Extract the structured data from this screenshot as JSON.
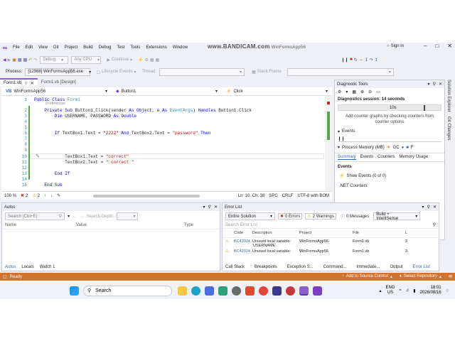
{
  "menu": {
    "items": [
      "File",
      "Edit",
      "View",
      "Git",
      "Project",
      "Build",
      "Debug",
      "Test",
      "Tools",
      "Extensions",
      "Window"
    ],
    "overlay": "www.BANDICAM.com",
    "app_name": "WinFormsApp56",
    "sign_in": "Sign in"
  },
  "toolbar": {
    "debug_config": "Debug",
    "cpu": "Any CPU",
    "continue": "Continue",
    "stack_frame_label": "Stack Frame"
  },
  "process_bar": {
    "label": "Process:",
    "value": "[12988] WinFormsApp56.exe",
    "lifecycle": "Lifecycle Events",
    "thread": "Thread:"
  },
  "tabs": [
    "Form1.vb",
    "Form1.vb [Design]"
  ],
  "editor_nav": {
    "project": "WinFormsApp56",
    "object": "Button1",
    "event": "Click"
  },
  "code": {
    "refs": "0 references",
    "lines": [
      {
        "n": "1",
        "parts": [
          [
            "kw",
            "Public Class "
          ],
          [
            "ty",
            "Form1"
          ]
        ]
      },
      {
        "n": "2",
        "parts": [
          [
            "kw",
            "    Private Sub "
          ],
          [
            "",
            "Button1_Click(sender "
          ],
          [
            "kw",
            "As Object"
          ],
          [
            "",
            ", e "
          ],
          [
            "kw",
            "As "
          ],
          [
            "ty",
            "EventArgs"
          ],
          [
            "",
            ") "
          ],
          [
            "kw",
            "Handles "
          ],
          [
            "",
            "Button1.Click"
          ]
        ]
      },
      {
        "n": "3",
        "parts": [
          [
            "kw",
            "        Dim "
          ],
          [
            "",
            "USERNAME, PASSWORD "
          ],
          [
            "kw",
            "As Double"
          ]
        ]
      },
      {
        "n": "4",
        "parts": []
      },
      {
        "n": "5",
        "parts": []
      },
      {
        "n": "6",
        "parts": [
          [
            "kw",
            "        If "
          ],
          [
            "",
            "TextBox1.Text = "
          ],
          [
            "st",
            "\"2222\""
          ],
          [
            "kw",
            " And "
          ],
          [
            "",
            "TextBox2.Text = "
          ],
          [
            "st",
            "\"password\""
          ],
          [
            "kw",
            " Then"
          ]
        ]
      },
      {
        "n": "7",
        "parts": []
      },
      {
        "n": "8",
        "parts": []
      },
      {
        "n": "9",
        "parts": []
      },
      {
        "n": "10",
        "parts": [
          [
            "",
            "            TextBox1.Text = "
          ],
          [
            "st",
            "\"correct\""
          ]
        ]
      },
      {
        "n": "11",
        "parts": [
          [
            "",
            "            TextBox2.Text = "
          ],
          [
            "st",
            "\" correct \""
          ]
        ]
      },
      {
        "n": "12",
        "parts": []
      },
      {
        "n": "13",
        "parts": [
          [
            "kw",
            "        End If"
          ]
        ]
      },
      {
        "n": "14",
        "parts": []
      },
      {
        "n": "15",
        "parts": [
          [
            "kw",
            "    End Sub"
          ]
        ]
      }
    ]
  },
  "editor_status": {
    "zoom": "100 %",
    "errors": "2",
    "warnings": "2",
    "position": "Ln: 10, Ch: 38",
    "spc": "SPC",
    "crlf": "CRLF",
    "encoding": "UTF-8 with BOM"
  },
  "diagnostics": {
    "title": "Diagnostic Tools",
    "session": "Diagnostics session: 14 seconds",
    "ticks": "10s",
    "hint": "Add counter graphs by checking counters from counter options",
    "events_header": "Events",
    "process_memory": "Process Memory (MB)",
    "tabs": [
      "Summary",
      "Events",
      "Counters",
      "Memory Usage"
    ],
    "events_label": "Events",
    "show_events": "Show Events (0 of 0)",
    "net_counters": ".NET Counters"
  },
  "side_tabs": [
    "Solution Explorer",
    "Git Changes"
  ],
  "autos": {
    "title": "Autos",
    "search_placeholder": "Search (Ctrl+E)",
    "search_depth": "Search Depth:",
    "columns": [
      "Name",
      "Value",
      "Type"
    ],
    "bottom_tabs": [
      "Autos",
      "Locals",
      "Watch 1"
    ]
  },
  "error_list": {
    "title": "Error List",
    "scope": "Entire Solution",
    "errors": "0 Errors",
    "warnings": "2 Warnings",
    "messages": "0 Messages",
    "build": "Build + IntelliSense",
    "search_placeholder": "Search Error List",
    "columns": [
      "",
      "Code",
      "Description",
      "Project",
      "File",
      "L"
    ],
    "rows": [
      {
        "code": "BC42024",
        "desc": "Unused local variable: 'USERNAME'.",
        "project": "WinFormsApp56",
        "file": "Form1.vb",
        "line": "3"
      },
      {
        "code": "BC42024",
        "desc": "Unused local variable:",
        "project": "WinFormsApp56",
        "file": "Form1.vb",
        "line": "3"
      }
    ],
    "bottom_tabs": [
      "Call Stack",
      "Breakpoints",
      "Exception S...",
      "Command...",
      "Immediate...",
      "Output",
      "Error List"
    ]
  },
  "status_bar": {
    "ready": "Ready",
    "source_control": "Add to Source Control",
    "repository": "Select Repository"
  },
  "taskbar": {
    "search": "Search",
    "lang": "ENG",
    "region": "US",
    "time": "18:01",
    "date": "2026/08/16"
  },
  "colors": {
    "accent": "#8b5fd3",
    "status_bar": "#d1722f",
    "keyword": "#0000ff",
    "type": "#2b91af",
    "string": "#a31515"
  }
}
